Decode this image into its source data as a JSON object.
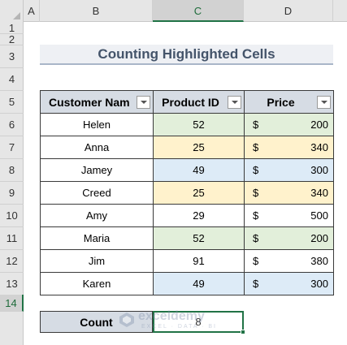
{
  "columns": [
    "A",
    "B",
    "C",
    "D"
  ],
  "selected_column": "C",
  "rows": [
    "1",
    "2",
    "3",
    "4",
    "5",
    "6",
    "7",
    "8",
    "9",
    "10",
    "11",
    "12",
    "13",
    "14"
  ],
  "selected_row": "14",
  "title": "Counting Highlighted Cells",
  "table": {
    "headers": [
      "Customer Nam",
      "Product ID",
      "Price"
    ],
    "currency": "$",
    "rows": [
      {
        "name": "Helen",
        "id": "52",
        "price": "200",
        "fill": "#e2efda"
      },
      {
        "name": "Anna",
        "id": "25",
        "price": "340",
        "fill": "#fff2cc"
      },
      {
        "name": "Jamey",
        "id": "49",
        "price": "300",
        "fill": "#ddebf7"
      },
      {
        "name": "Creed",
        "id": "25",
        "price": "340",
        "fill": "#fff2cc"
      },
      {
        "name": "Amy",
        "id": "29",
        "price": "500",
        "fill": "#ffffff"
      },
      {
        "name": "Maria",
        "id": "52",
        "price": "200",
        "fill": "#e2efda"
      },
      {
        "name": "Jim",
        "id": "91",
        "price": "380",
        "fill": "#ffffff"
      },
      {
        "name": "Karen",
        "id": "49",
        "price": "300",
        "fill": "#ddebf7"
      }
    ]
  },
  "count": {
    "label": "Count",
    "value": "8"
  },
  "watermark": {
    "name": "exceldemy",
    "sub": "EXCEL · DATA · BI"
  },
  "colors": {
    "selection": "#217346",
    "header_fill": "#d6dce4",
    "title_text": "#44546a"
  }
}
